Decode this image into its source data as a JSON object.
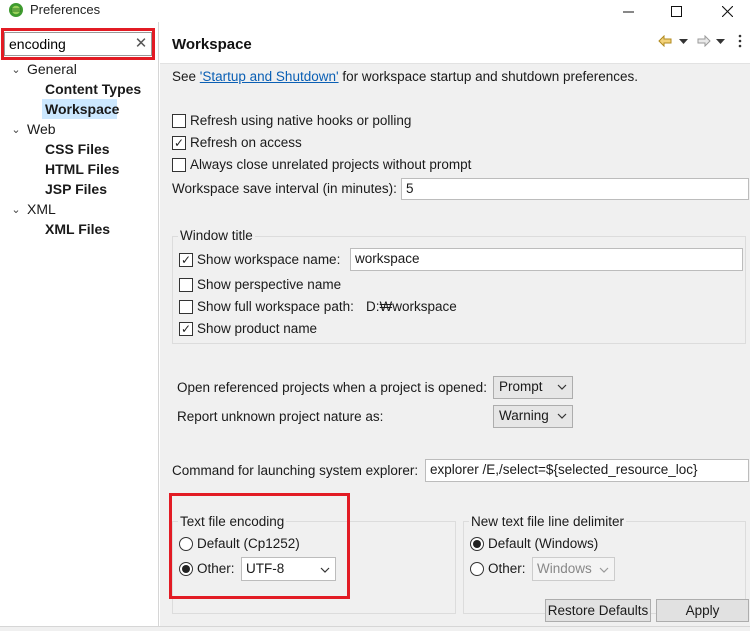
{
  "window": {
    "title": "Preferences",
    "minimize_icon": "minimize-icon",
    "maximize_icon": "maximize-icon",
    "close_icon": "close-icon"
  },
  "search": {
    "value": "encoding",
    "clear_glyph": "✕"
  },
  "tree": {
    "general": "General",
    "content_types": "Content Types",
    "workspace": "Workspace",
    "web": "Web",
    "css_files": "CSS Files",
    "html_files": "HTML Files",
    "jsp_files": "JSP Files",
    "xml": "XML",
    "xml_files": "XML Files"
  },
  "page": {
    "title": "Workspace",
    "see_prefix": "See",
    "see_link": "'Startup and Shutdown'",
    "see_suffix": "for workspace startup and shutdown preferences.",
    "refresh_native": "Refresh using native hooks or polling",
    "refresh_native_checked": false,
    "refresh_access": "Refresh on access",
    "refresh_access_checked": true,
    "always_close": "Always close unrelated projects without prompt",
    "always_close_checked": false,
    "save_interval_label": "Workspace save interval (in minutes):",
    "save_interval_value": "5"
  },
  "window_title_group": {
    "title": "Window title",
    "show_ws_name": "Show workspace name:",
    "show_ws_name_checked": true,
    "ws_name_value": "workspace",
    "show_perspective": "Show perspective name",
    "show_perspective_checked": false,
    "show_full_path": "Show full workspace path:",
    "show_full_path_checked": false,
    "full_path_value": "D:₩workspace",
    "show_product": "Show product name",
    "show_product_checked": true
  },
  "projects": {
    "open_ref_label": "Open referenced projects when a project is opened:",
    "open_ref_value": "Prompt",
    "unknown_nature_label": "Report unknown project nature as:",
    "unknown_nature_value": "Warning"
  },
  "explorer": {
    "label": "Command for launching system explorer:",
    "value": "explorer /E,/select=${selected_resource_loc}"
  },
  "encoding": {
    "title": "Text file encoding",
    "default_label": "Default (Cp1252)",
    "other_label": "Other:",
    "selected": "other",
    "other_value": "UTF-8"
  },
  "line_delim": {
    "title": "New text file line delimiter",
    "default_label": "Default (Windows)",
    "other_label": "Other:",
    "selected": "default",
    "other_value": "Windows"
  },
  "buttons": {
    "restore": "Restore Defaults",
    "apply": "Apply"
  },
  "colors": {
    "highlight_box": "#e21b24",
    "selection": "#cce8ff",
    "link": "#0a5fb4"
  }
}
